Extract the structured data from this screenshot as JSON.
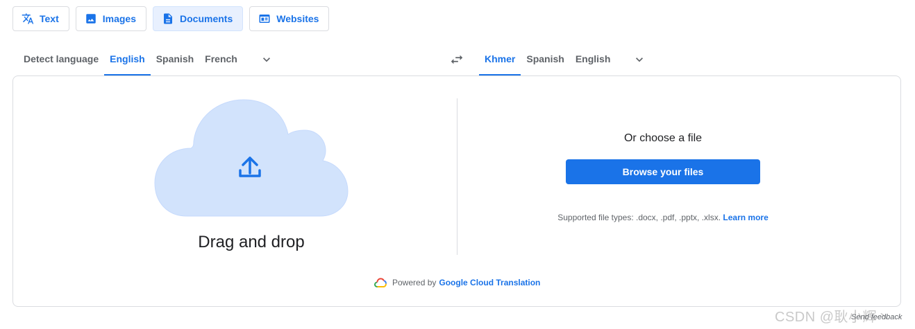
{
  "mode_tabs": [
    {
      "label": "Text",
      "icon": "translate-icon",
      "active": false
    },
    {
      "label": "Images",
      "icon": "image-icon",
      "active": false
    },
    {
      "label": "Documents",
      "icon": "document-icon",
      "active": true
    },
    {
      "label": "Websites",
      "icon": "website-icon",
      "active": false
    }
  ],
  "source_langs": [
    "Detect language",
    "English",
    "Spanish",
    "French"
  ],
  "source_active": "English",
  "target_langs": [
    "Khmer",
    "Spanish",
    "English"
  ],
  "target_active": "Khmer",
  "drop": {
    "label": "Drag and drop"
  },
  "choose": {
    "title": "Or choose a file",
    "browse_label": "Browse your files",
    "supported_text": "Supported file types: .docx, .pdf, .pptx, .xlsx.",
    "learn_more": "Learn more"
  },
  "footer": {
    "powered_by": "Powered by",
    "link": "Google Cloud Translation"
  },
  "watermark": "CSDN @耿小辉丶",
  "feedback": "Send feedback",
  "colors": {
    "accent": "#1a73e8",
    "active_tab_bg": "#e8f0fe",
    "cloud": "#d2e3fc"
  }
}
